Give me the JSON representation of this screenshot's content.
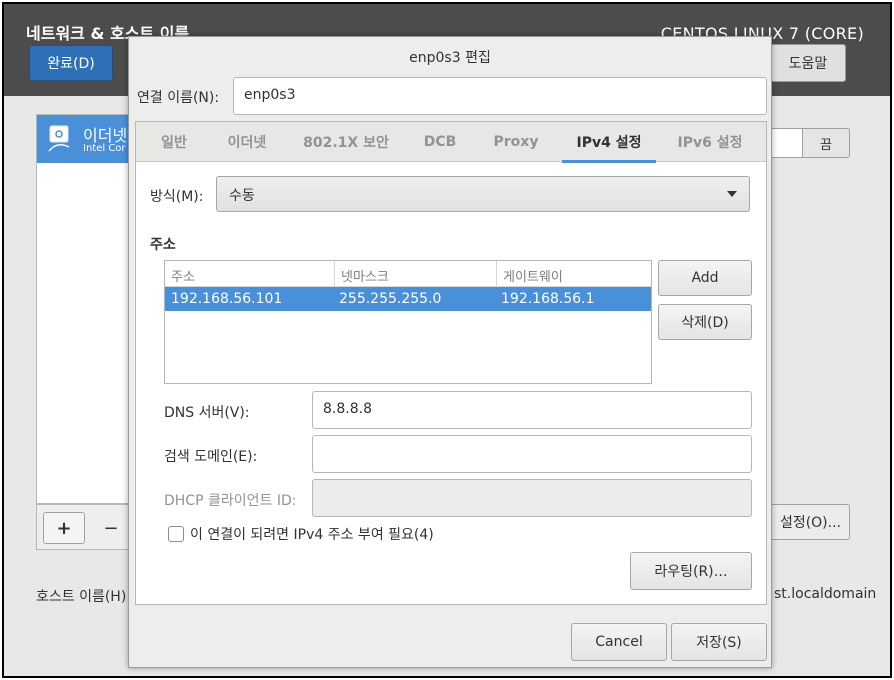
{
  "background": {
    "title": "네트워크 & 호스트 이름",
    "os_label": "CENTOS LINUX 7 (CORE)",
    "done_button": "완료(D)",
    "help_button": "도움말",
    "device": {
      "name": "이더넷",
      "subtitle": "Intel Cor"
    },
    "toggle_off": "끔",
    "add_button": "+",
    "remove_button": "−",
    "configure_button": "설정(O)...",
    "hostname_label": "호스트 이름(H)",
    "hostname_value": "st.localdomain"
  },
  "dialog": {
    "title": "enp0s3 편집",
    "connection_name_label": "연결 이름(N):",
    "connection_name_value": "enp0s3",
    "tabs": [
      {
        "label": "일반",
        "active": false
      },
      {
        "label": "이더넷",
        "active": false
      },
      {
        "label": "802.1X 보안",
        "active": false
      },
      {
        "label": "DCB",
        "active": false
      },
      {
        "label": "Proxy",
        "active": false
      },
      {
        "label": "IPv4 설정",
        "active": true
      },
      {
        "label": "IPv6 설정",
        "active": false
      }
    ],
    "method_label": "방식(M):",
    "method_value": "수동",
    "addresses_heading": "주소",
    "address_table": {
      "columns": [
        "주소",
        "넷마스크",
        "게이트웨이"
      ],
      "rows": [
        [
          "192.168.56.101",
          "255.255.255.0",
          "192.168.56.1"
        ]
      ]
    },
    "add_button": "Add",
    "delete_button": "삭제(D)",
    "dns_label": "DNS 서버(V):",
    "dns_value": "8.8.8.8",
    "search_domain_label": "검색 도메인(E):",
    "search_domain_value": "",
    "dhcp_client_id_label": "DHCP 클라이언트 ID:",
    "dhcp_client_id_value": "",
    "require_ipv4_label": "이 연결이 되려면 IPv4 주소 부여 필요(4)",
    "routes_button": "라우팅(R)…",
    "cancel_button": "Cancel",
    "save_button": "저장(S)"
  }
}
